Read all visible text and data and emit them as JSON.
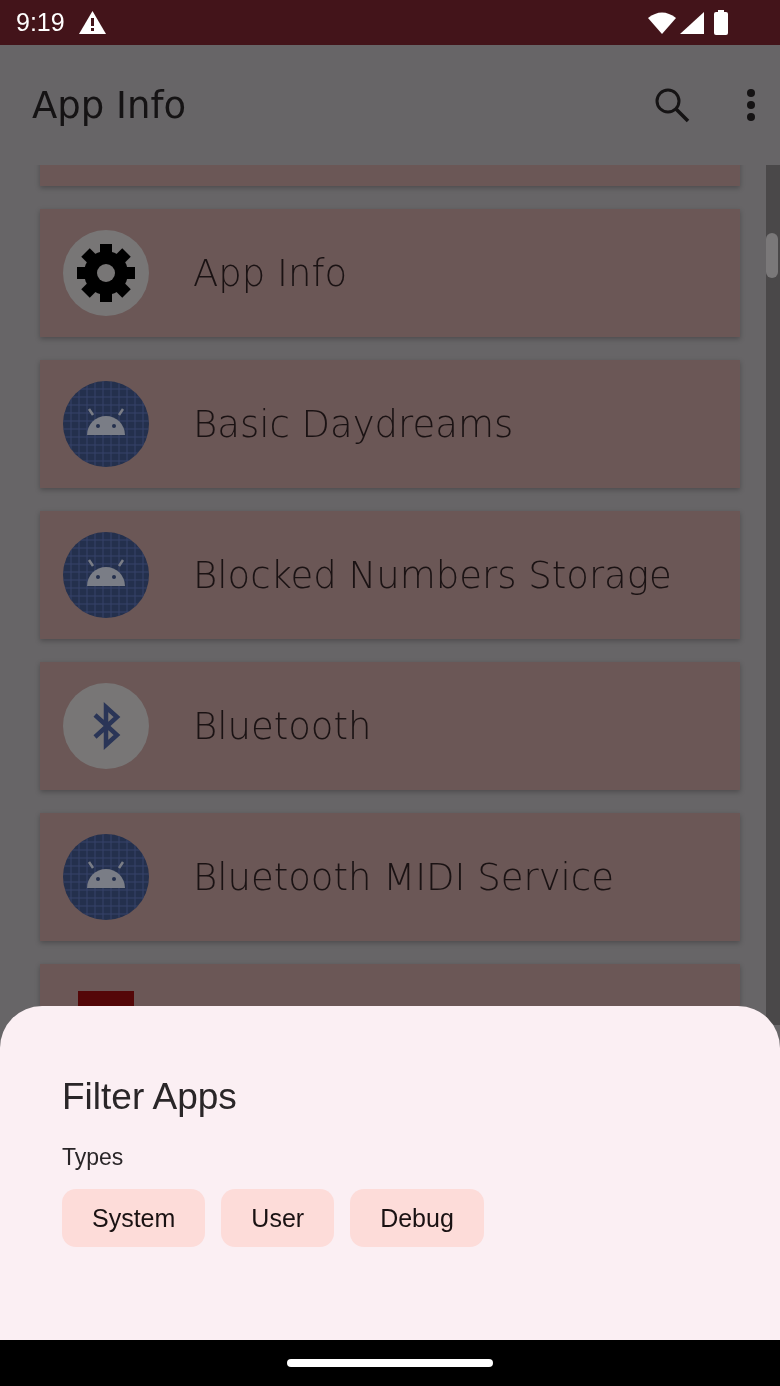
{
  "status_bar": {
    "time": "9:19"
  },
  "app_bar": {
    "title": "App Info"
  },
  "apps": [
    {
      "kind": "blank"
    },
    {
      "name": "App Info",
      "kind": "gear"
    },
    {
      "name": "Basic Daydreams",
      "kind": "android"
    },
    {
      "name": "Blocked Numbers Storage",
      "kind": "android"
    },
    {
      "name": "Bluetooth",
      "kind": "bluetooth"
    },
    {
      "name": "Bluetooth MIDI Service",
      "kind": "android"
    },
    {
      "kind": "red-square"
    }
  ],
  "filter_sheet": {
    "title": "Filter Apps",
    "section": "Types",
    "chips": [
      {
        "label": "System",
        "selected": false
      },
      {
        "label": "User",
        "selected": false
      },
      {
        "label": "Debug",
        "selected": false
      }
    ]
  }
}
